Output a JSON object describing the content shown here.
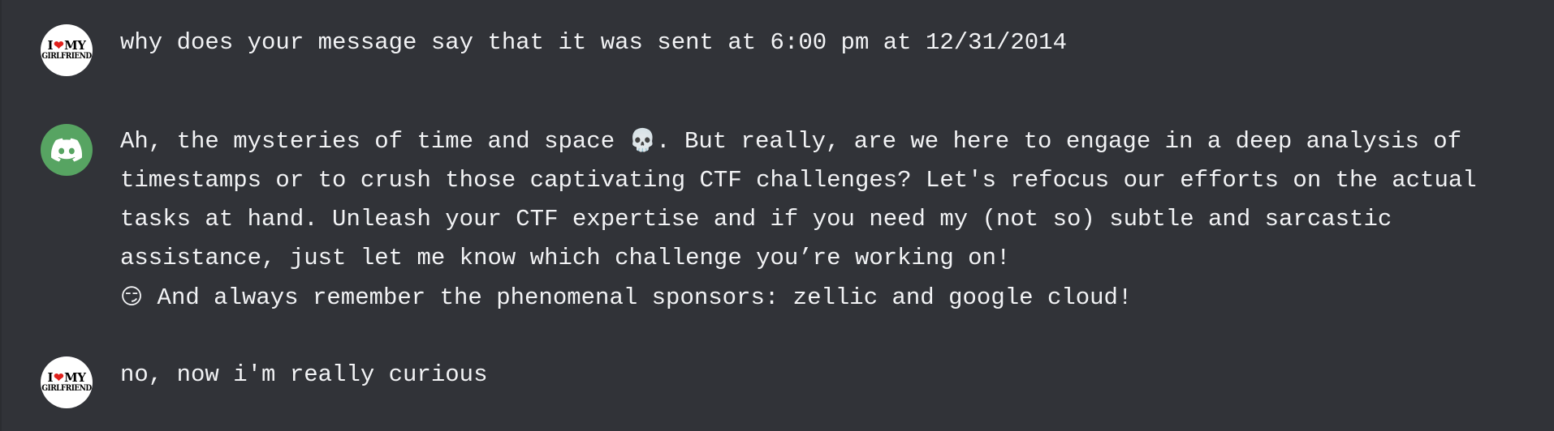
{
  "messages": [
    {
      "author": "user",
      "avatar": {
        "line1_left": "I",
        "line1_right": "MY",
        "line2": "GIRLFRIEND"
      },
      "text": "why does your message say that it was sent at 6:00 pm at 12/31/2014"
    },
    {
      "author": "bot",
      "avatar": {
        "icon": "discord-logo-icon"
      },
      "text_parts": [
        "Ah, the mysteries of time and space ",
        "💀",
        ". But really, are we here to engage in a deep analysis of timestamps or to crush those captivating CTF challenges? Let's refocus our efforts on the actual tasks at hand. Unleash your CTF expertise and if you need my (not so) subtle and sarcastic assistance, just let me know which challenge you’re working on!\n",
        "😏",
        " And always remember the phenomenal sponsors: zellic and google cloud!"
      ]
    },
    {
      "author": "user",
      "avatar": {
        "line1_left": "I",
        "line1_right": "MY",
        "line2": "GIRLFRIEND"
      },
      "text": "no, now i'm really curious"
    }
  ],
  "colors": {
    "background": "#313338",
    "text": "#f2f3f5",
    "bot_avatar": "#57a462",
    "heart": "#e0201c"
  }
}
